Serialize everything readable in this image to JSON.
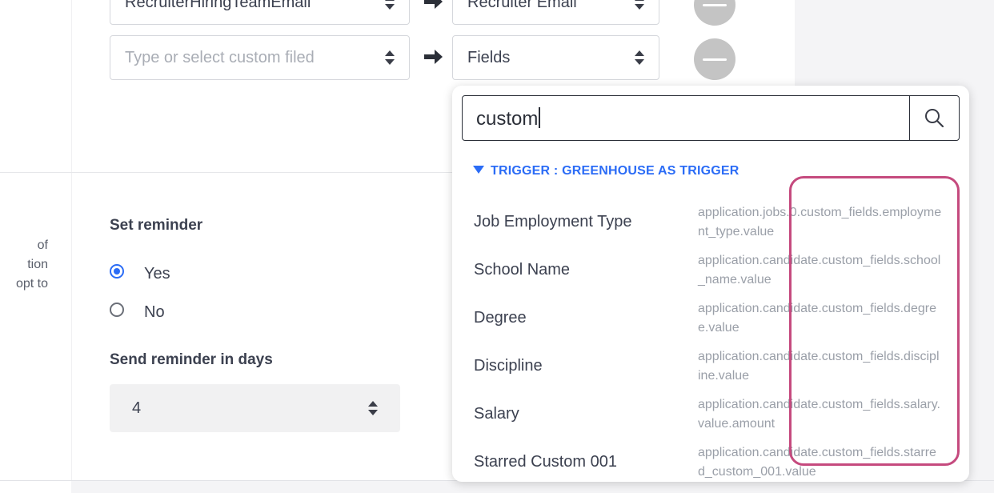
{
  "mapping": {
    "row1": {
      "source": "RecruiterHiringTeamEmail",
      "target": "Recruiter Email"
    },
    "row2": {
      "source_placeholder": "Type or select custom filed",
      "target": "Fields"
    }
  },
  "side_text": [
    "of",
    "tion",
    "opt to"
  ],
  "reminder": {
    "title": "Set reminder",
    "yes_label": "Yes",
    "no_label": "No",
    "days_title": "Send reminder in days",
    "days_value": "4"
  },
  "dropdown": {
    "search_value": "custom",
    "group_label": "TRIGGER : GREENHOUSE AS TRIGGER",
    "options": [
      {
        "name": "Job Employment Type",
        "path": "application.jobs.0.custom_fields.employment_type.value"
      },
      {
        "name": "School Name",
        "path": "application.candidate.custom_fields.school_name.value"
      },
      {
        "name": "Degree",
        "path": "application.candidate.custom_fields.degree.value"
      },
      {
        "name": "Discipline",
        "path": "application.candidate.custom_fields.discipline.value"
      },
      {
        "name": "Salary",
        "path": "application.candidate.custom_fields.salary.value.amount"
      },
      {
        "name": "Starred Custom 001",
        "path": "application.candidate.custom_fields.starred_custom_001.value"
      }
    ]
  },
  "colors": {
    "accent": "#2b6cf6",
    "highlight": "#c54a7e",
    "remove_button": "#c4c4c4"
  }
}
